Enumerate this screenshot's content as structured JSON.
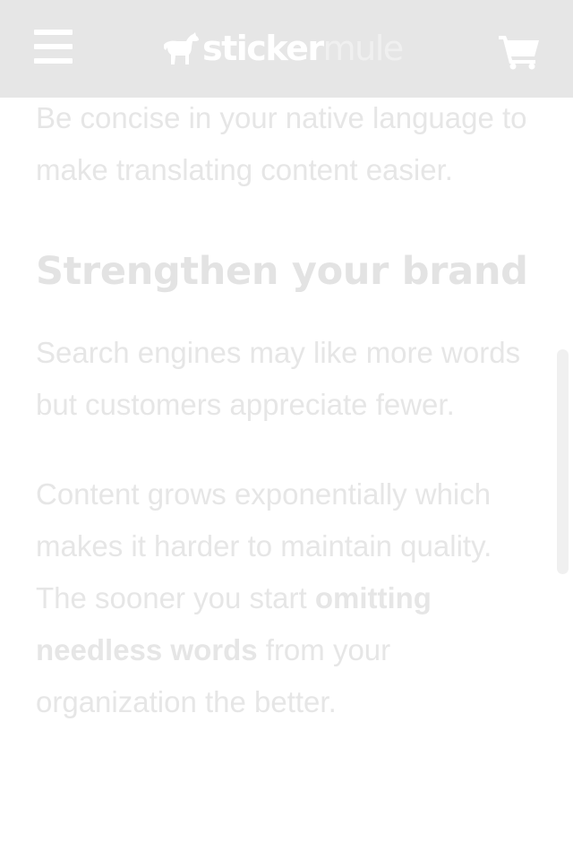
{
  "header": {
    "menu_icon": "hamburger-menu-icon",
    "logo_word_bold": "sticker",
    "logo_word_light": "mule",
    "cart_icon": "shopping-cart-icon"
  },
  "article": {
    "intro_text": "Be concise in your native language to make translating content easier.",
    "section_heading": "Strengthen your brand",
    "paragraph_1": "Search engines may like more words but customers appreciate fewer.",
    "paragraph_2_before": "Content grows exponentially which makes it harder to maintain quality. The sooner you start ",
    "paragraph_2_bold": "omitting needless words",
    "paragraph_2_after": " from your organization the better."
  },
  "colors": {
    "header_bg": "#e6e6e6",
    "text": "#e6e6e6",
    "page_bg": "#ffffff"
  }
}
